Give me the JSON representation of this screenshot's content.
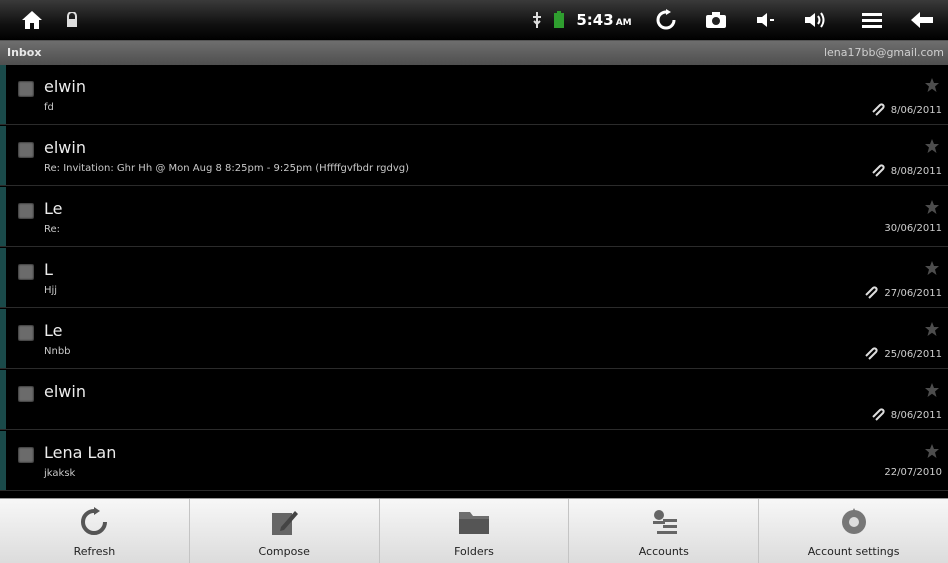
{
  "statusbar": {
    "time": "5:43",
    "ampm": "AM",
    "icons": [
      "home-icon",
      "lock-icon",
      "usb-icon",
      "battery-icon",
      "refresh-icon",
      "camera-icon",
      "volume-down-icon",
      "volume-up-icon",
      "menu-icon",
      "back-icon"
    ]
  },
  "header": {
    "title": "Inbox",
    "account": "lena17bb@gmail.com"
  },
  "messages": [
    {
      "sender": "elwin",
      "subject": "fd",
      "date": "8/06/2011",
      "attachment": true
    },
    {
      "sender": "elwin",
      "subject": "Re: Invitation: Ghr Hh @ Mon Aug 8 8:25pm - 9:25pm (Hffffgvfbdr rgdvg)",
      "date": "8/08/2011",
      "attachment": true
    },
    {
      "sender": "Le",
      "subject": "Re:",
      "date": "30/06/2011",
      "attachment": false
    },
    {
      "sender": "L",
      "subject": "Hjj",
      "date": "27/06/2011",
      "attachment": true
    },
    {
      "sender": "Le",
      "subject": "Nnbb",
      "date": "25/06/2011",
      "attachment": true
    },
    {
      "sender": "elwin",
      "subject": "",
      "date": "8/06/2011",
      "attachment": true
    },
    {
      "sender": "Lena Lan",
      "subject": "jkaksk",
      "date": "22/07/2010",
      "attachment": false
    }
  ],
  "toolbar": {
    "refresh": "Refresh",
    "compose": "Compose",
    "folders": "Folders",
    "accounts": "Accounts",
    "account_settings": "Account settings"
  },
  "colors": {
    "background": "#000000",
    "toolbar": "#e8e8e8",
    "checkbox": "#6b6b6b",
    "accent_edge": "#1a4a4a"
  }
}
